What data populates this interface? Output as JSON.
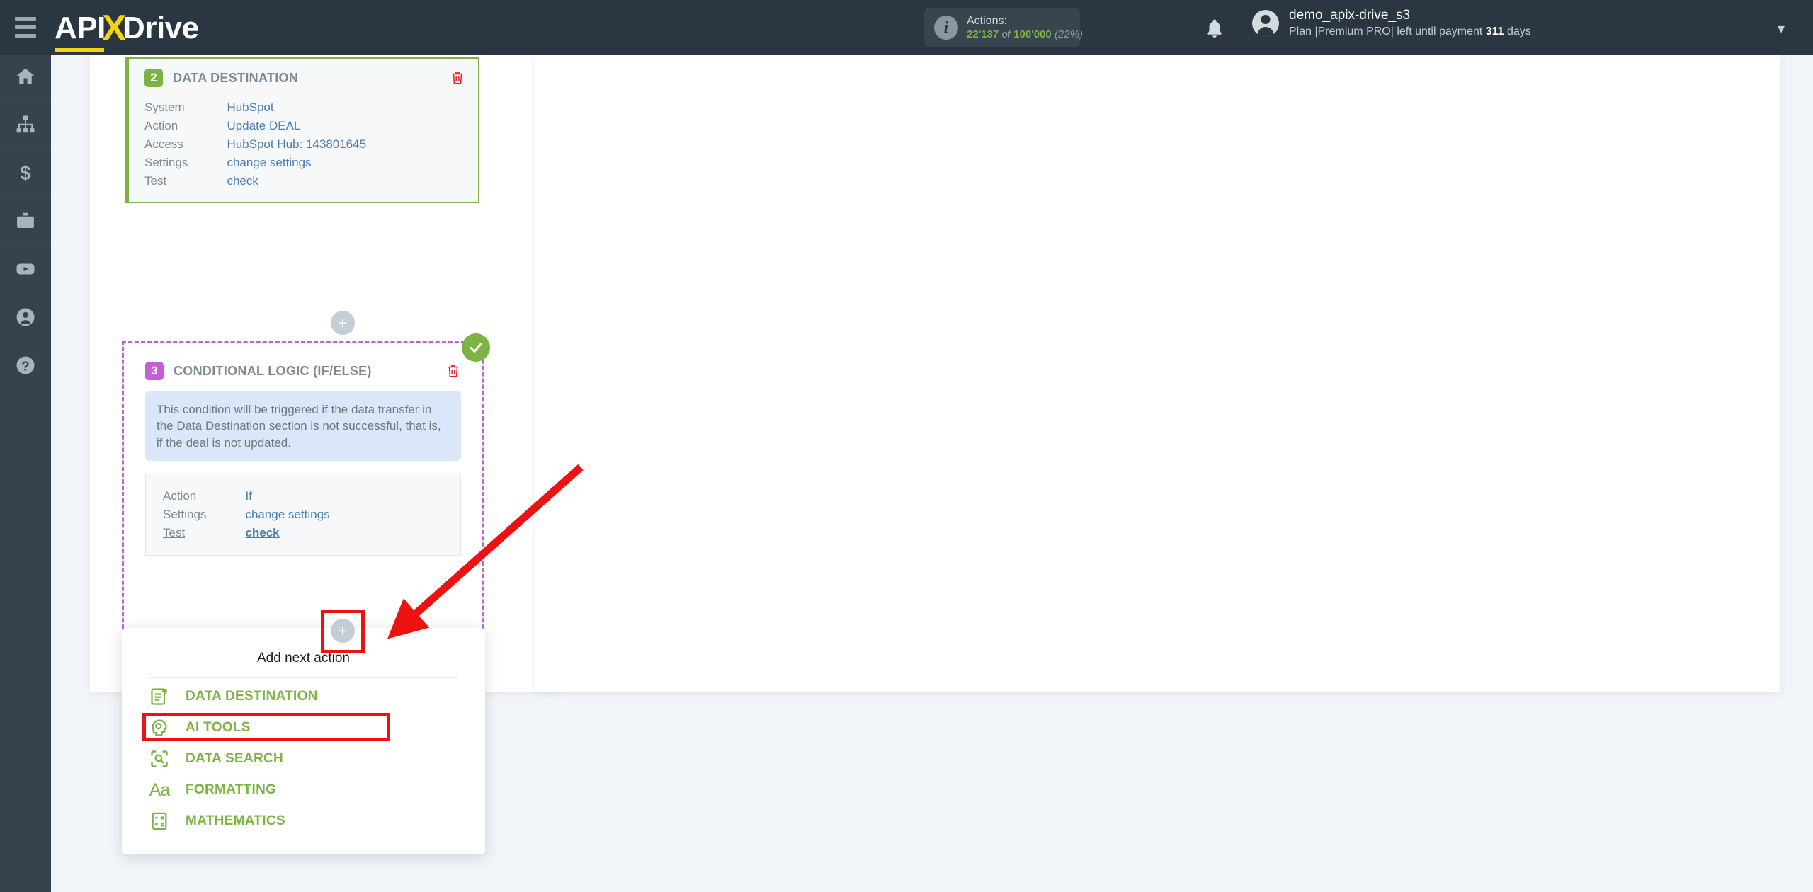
{
  "header": {
    "menu_icon": "hamburger-icon",
    "logo": {
      "part1": "API",
      "part2": "X",
      "part3": "Drive"
    },
    "actions": {
      "label": "Actions:",
      "used": "22'137",
      "of": "of",
      "total": "100'000",
      "percent": "(22%)"
    },
    "notifications_icon": "bell-icon",
    "user": {
      "name": "demo_apix-drive_s3",
      "plan_prefix": "Plan |Premium PRO| left until payment ",
      "plan_days": "311",
      "plan_suffix": " days"
    },
    "caret_icon": "chevron-down-icon"
  },
  "sidebar": {
    "items": [
      {
        "icon": "home-icon",
        "name": "home"
      },
      {
        "icon": "connections-icon",
        "name": "connections"
      },
      {
        "icon": "dollar-icon",
        "name": "billing"
      },
      {
        "icon": "briefcase-icon",
        "name": "business"
      },
      {
        "icon": "youtube-icon",
        "name": "video"
      },
      {
        "icon": "user-icon",
        "name": "account"
      },
      {
        "icon": "help-icon",
        "name": "help"
      }
    ]
  },
  "steps": {
    "step2": {
      "number": "2",
      "title": "DATA DESTINATION",
      "delete_icon": "trash-icon",
      "accent_color": "#7cb342",
      "rows": [
        {
          "key": "System",
          "value": "HubSpot"
        },
        {
          "key": "Action",
          "value": "Update DEAL"
        },
        {
          "key": "Access",
          "value": "HubSpot Hub: 143801645"
        },
        {
          "key": "Settings",
          "value": "change settings"
        },
        {
          "key": "Test",
          "value": "check"
        }
      ]
    },
    "step3": {
      "number": "3",
      "title": "CONDITIONAL LOGIC (IF/ELSE)",
      "delete_icon": "trash-icon",
      "accent_color": "#c35fd8",
      "status_icon": "check-circle-icon",
      "note": "This condition will be triggered if the data transfer in the Data Destination section is not successful, that is, if the deal is not updated.",
      "rows": [
        {
          "key": "Action",
          "value": "If"
        },
        {
          "key": "Settings",
          "value": "change settings"
        },
        {
          "key": "Test",
          "value": "check"
        }
      ]
    }
  },
  "connectors": {
    "plus_label": "+"
  },
  "menu": {
    "title": "Add next action",
    "items": [
      {
        "label": "DATA DESTINATION",
        "icon": "document-plus-icon"
      },
      {
        "label": "AI TOOLS",
        "icon": "ai-head-icon"
      },
      {
        "label": "DATA SEARCH",
        "icon": "search-frame-icon"
      },
      {
        "label": "FORMATTING",
        "icon": "aa-text-icon"
      },
      {
        "label": "MATHEMATICS",
        "icon": "calculator-icon"
      }
    ]
  },
  "annotations": {
    "highlight_color": "#ee1111",
    "arrow_icon": "red-arrow-icon"
  }
}
